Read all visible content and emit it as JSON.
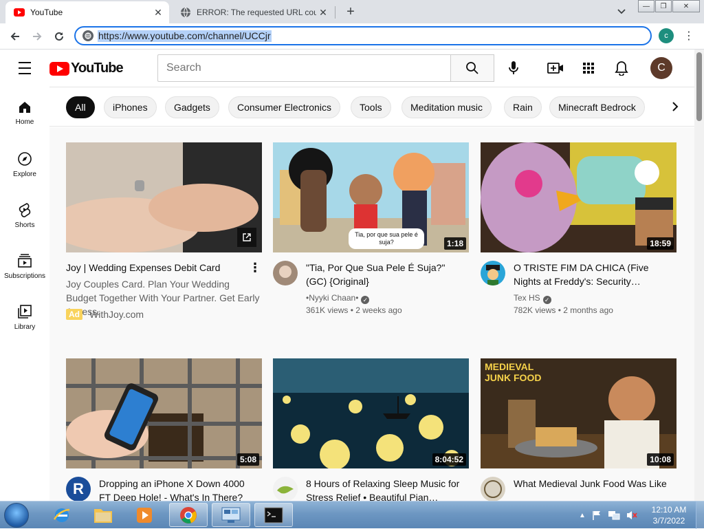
{
  "browser": {
    "tabs": [
      {
        "title": "YouTube",
        "active": true
      },
      {
        "title": "ERROR: The requested URL could",
        "active": false
      }
    ],
    "url": "https://www.youtube.com/channel/UCCjr",
    "profile_initial": "c"
  },
  "youtube": {
    "logo_text": "YouTube",
    "search_placeholder": "Search",
    "avatar_initial": "C",
    "sidebar": [
      {
        "label": "Home",
        "icon": "home-icon"
      },
      {
        "label": "Explore",
        "icon": "compass-icon"
      },
      {
        "label": "Shorts",
        "icon": "shorts-icon"
      },
      {
        "label": "Subscriptions",
        "icon": "subscriptions-icon"
      },
      {
        "label": "Library",
        "icon": "library-icon"
      }
    ],
    "chips": [
      "All",
      "iPhones",
      "Gadgets",
      "Consumer Electronics",
      "Tools",
      "Meditation music",
      "Rain",
      "Minecraft Bedrock"
    ],
    "videos": [
      {
        "kind": "ad",
        "title": "Joy | Wedding Expenses Debit Card",
        "description": "Joy Couples Card. Plan Your Wedding Budget Together With Your Partner. Get Early Access.",
        "ad_badge": "Ad",
        "advertiser": "WithJoy.com"
      },
      {
        "title": "\"Tia, Por Que Sua Pele É Suja?\" (GC) {Original}",
        "channel": "•Nyyki Chaan•",
        "verified": true,
        "stats": "361K views • 2 weeks ago",
        "duration": "1:18",
        "thumb_caption": "Tia, por que sua pele é suja?"
      },
      {
        "title": "O TRISTE FIM DA CHICA (Five Nights at Freddy's: Security…",
        "channel": "Tex HS",
        "verified": true,
        "stats": "782K views • 2 months ago",
        "duration": "18:59"
      },
      {
        "title": "Dropping an iPhone X Down 4000 FT Deep Hole! - What's In There?",
        "duration": "5:08",
        "channel_avatar_text": "R"
      },
      {
        "title": "8 Hours of Relaxing Sleep Music for Stress Relief • Beautiful Pian…",
        "duration": "8:04:52"
      },
      {
        "title": "What Medieval Junk Food Was Like",
        "duration": "10:08",
        "thumb_caption": "MEDIEVAL JUNK FOOD"
      }
    ]
  },
  "taskbar": {
    "time": "12:10 AM",
    "date": "3/7/2022"
  },
  "colors": {
    "youtube_red": "#ff0000",
    "chrome_focus_blue": "#1a73e8",
    "chip_active": "#0f0f0f"
  }
}
